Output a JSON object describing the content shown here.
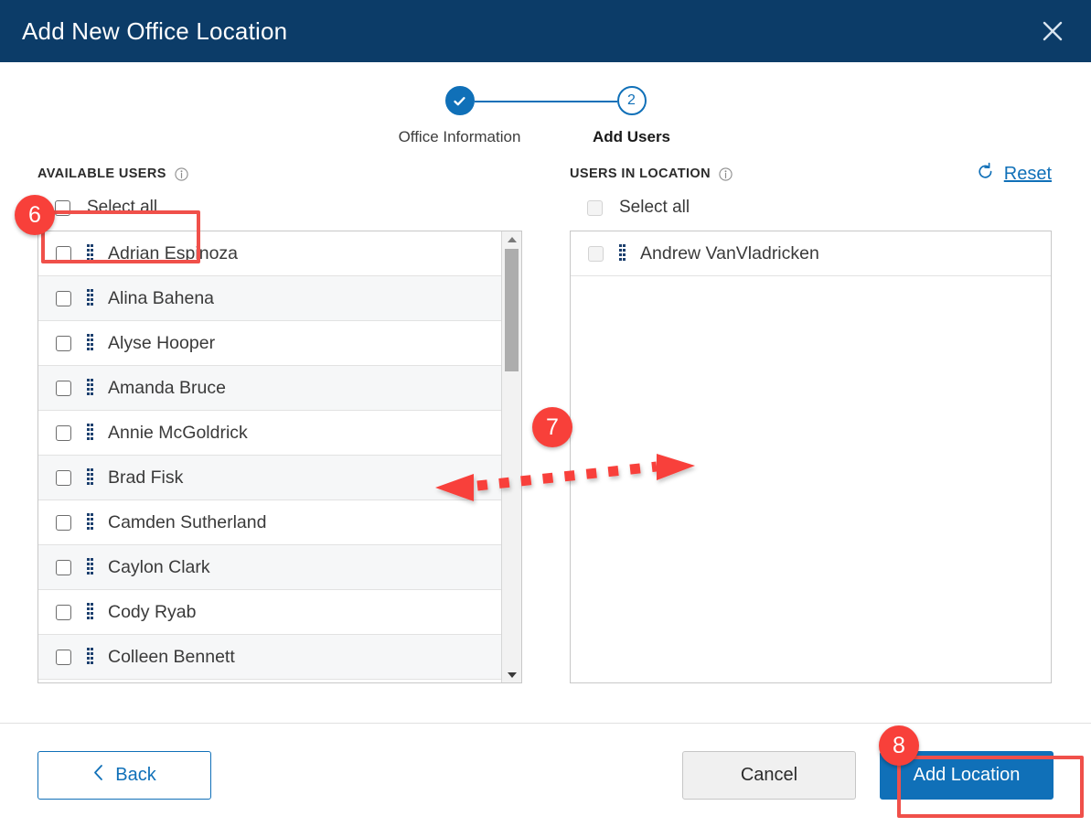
{
  "window": {
    "title": "Add New Office Location",
    "close_icon": "close-icon"
  },
  "stepper": {
    "steps": [
      {
        "label": "Office Information",
        "indicator": "check",
        "state": "completed"
      },
      {
        "label": "Add Users",
        "indicator": "2",
        "state": "active"
      }
    ]
  },
  "available_users": {
    "heading": "AVAILABLE USERS",
    "info_icon": "info-icon",
    "select_all_label": "Select all",
    "select_all_checked": false,
    "users": [
      "Adrian Espinoza",
      "Alina Bahena",
      "Alyse Hooper",
      "Amanda Bruce",
      "Annie McGoldrick",
      "Brad Fisk",
      "Camden Sutherland",
      "Caylon Clark",
      "Cody Ryab",
      "Colleen Bennett"
    ]
  },
  "users_in_location": {
    "heading": "USERS IN LOCATION",
    "info_icon": "info-icon",
    "reset_label": "Reset",
    "reset_icon": "refresh-icon",
    "select_all_label": "Select all",
    "select_all_disabled": true,
    "users": [
      "Andrew VanVladricken"
    ]
  },
  "footer": {
    "back_label": "Back",
    "back_icon": "chevron-left-icon",
    "cancel_label": "Cancel",
    "add_location_label": "Add Location"
  },
  "annotations": {
    "badges": [
      {
        "number": "6",
        "target": "select-all-available"
      },
      {
        "number": "7",
        "target": "drag-users-between-lists"
      },
      {
        "number": "8",
        "target": "add-location-button"
      }
    ],
    "accent_color": "#f8403a",
    "highlight_color": "#f0504a"
  },
  "colors": {
    "titlebar": "#0c3c68",
    "primary": "#1070b8",
    "link": "#1070b8",
    "row_alt": "#f6f7f8"
  }
}
